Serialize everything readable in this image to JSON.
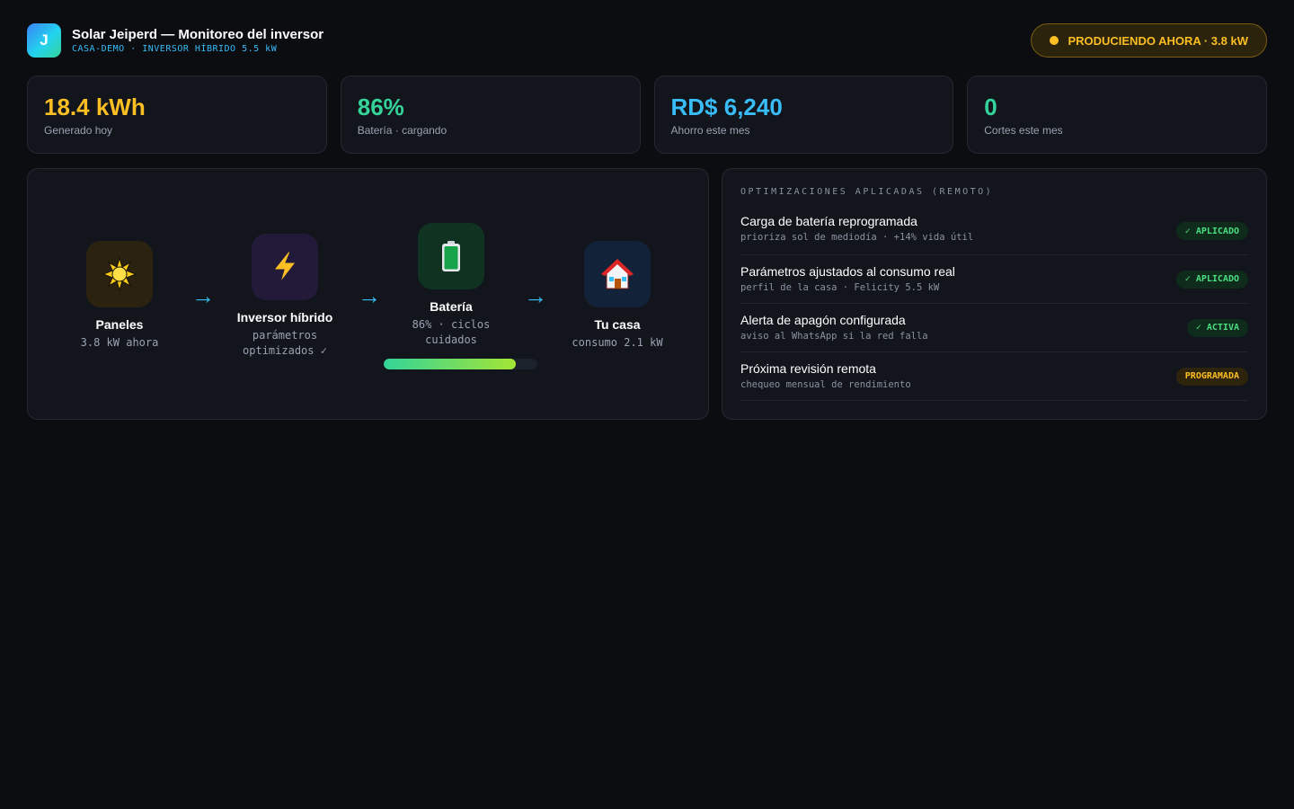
{
  "header": {
    "logo_letter": "J",
    "title": "Solar Jeiperd — Monitoreo del inversor",
    "subtitle": "CASA-DEMO · INVERSOR HÍBRIDO 5.5 kW",
    "status": "PRODUCIENDO AHORA · 3.8 kW"
  },
  "stats": [
    {
      "value": "18.4 kWh",
      "label": "Generado hoy",
      "color": "#fbbf24"
    },
    {
      "value": "86%",
      "label": "Batería · cargando",
      "color": "#34d399"
    },
    {
      "value": "RD$ 6,240",
      "label": "Ahorro este mes",
      "color": "#38bdf8"
    },
    {
      "value": "0",
      "label": "Cortes este mes",
      "color": "#34d399"
    }
  ],
  "flow": {
    "panels": {
      "icon": "sun-icon",
      "name": "Paneles",
      "sub": "3.8 kW ahora"
    },
    "inverter": {
      "icon": "lightning-icon",
      "name": "Inversor híbrido",
      "sub_line1": "parámetros",
      "sub_line2": "optimizados ✓"
    },
    "battery": {
      "icon": "battery-icon",
      "name": "Batería",
      "sub_line1": "86% · ciclos",
      "sub_line2": "cuidados",
      "level_percent": 86
    },
    "house": {
      "icon": "house-icon",
      "name": "Tu casa",
      "sub": "consumo 2.1 kW"
    },
    "arrow_glyph": "→"
  },
  "optimizations": {
    "heading": "OPTIMIZACIONES APLICADAS (REMOTO)",
    "items": [
      {
        "title": "Carga de batería reprogramada",
        "desc": "prioriza sol de mediodía · +14% vida útil",
        "badge": "✓ APLICADO"
      },
      {
        "title": "Parámetros ajustados al consumo real",
        "desc": "perfil de la casa · Felicity 5.5 kW",
        "badge": "✓ APLICADO"
      },
      {
        "title": "Alerta de apagón configurada",
        "desc": "aviso al WhatsApp si la red falla",
        "badge": "✓ ACTIVA"
      },
      {
        "title": "Próxima revisión remota",
        "desc": "chequeo mensual de rendimiento",
        "badge": "PROGRAMADA"
      }
    ]
  }
}
